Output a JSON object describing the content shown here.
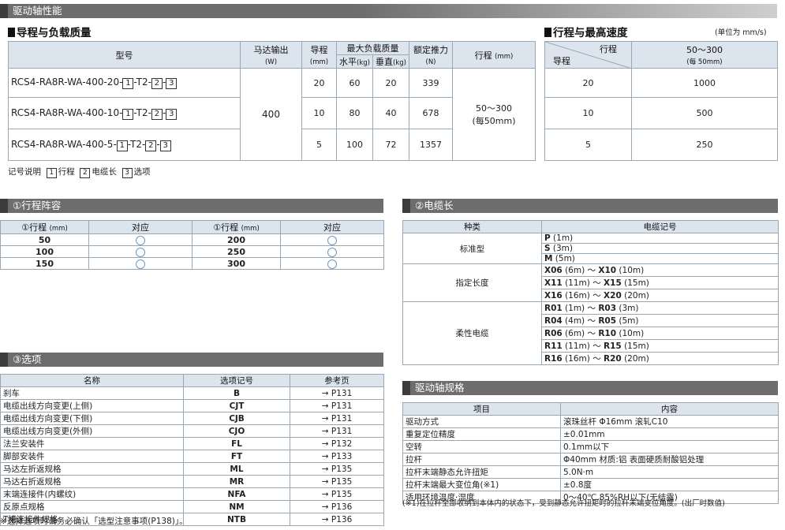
{
  "top_band": "驱动轴性能",
  "lead_section": {
    "title": "导程与负载质量",
    "headers": {
      "model": "型号",
      "motor": "马达输出",
      "motor_unit": "(W)",
      "lead": "导程",
      "lead_unit": "(mm)",
      "max_load": "最大负载质量",
      "horiz": "水平",
      "horiz_unit": "(kg)",
      "vert": "垂直",
      "vert_unit": "(kg)",
      "thrust": "额定推力",
      "thrust_unit": "(N)",
      "stroke": "行程",
      "stroke_unit": "(mm)"
    },
    "model_suffix": {
      "a": "-T2-",
      "b": "-"
    },
    "rows": [
      {
        "model_prefix": "RCS4-RA8R-WA-400-20-",
        "lead": "20",
        "horiz": "60",
        "vert": "20",
        "thrust": "339"
      },
      {
        "model_prefix": "RCS4-RA8R-WA-400-10-",
        "lead": "10",
        "horiz": "80",
        "vert": "40",
        "thrust": "678"
      },
      {
        "model_prefix": "RCS4-RA8R-WA-400-5-",
        "lead": "5",
        "horiz": "100",
        "vert": "72",
        "thrust": "1357"
      }
    ],
    "motor_value": "400",
    "stroke_value": "50～300",
    "stroke_pitch": "(每50mm)",
    "legend_label": "记号说明",
    "legend": [
      {
        "num": "1",
        "text": "行程"
      },
      {
        "num": "2",
        "text": "电缆长"
      },
      {
        "num": "3",
        "text": "选项"
      }
    ]
  },
  "speed_section": {
    "title": "行程与最高速度",
    "unit": "(单位为 mm/s)",
    "corner_top": "行程",
    "corner_bottom": "导程",
    "stroke_head": "50～300",
    "stroke_head_sub": "(每 50mm)",
    "rows": [
      {
        "lead": "20",
        "speed": "1000"
      },
      {
        "lead": "10",
        "speed": "500"
      },
      {
        "lead": "5",
        "speed": "250"
      }
    ]
  },
  "stroke_table": {
    "band": "①行程阵容",
    "headers": [
      "①行程",
      "(mm)",
      "对应"
    ],
    "left": [
      "50",
      "100",
      "150"
    ],
    "right": [
      "200",
      "250",
      "300"
    ]
  },
  "cable_table": {
    "band": "②电缆长",
    "headers": [
      "种类",
      "电缆记号"
    ],
    "groups": [
      {
        "type": "标准型",
        "lines": [
          {
            "a": "P",
            "an": "(1m)",
            "b": "",
            "bn": ""
          },
          {
            "a": "S",
            "an": "(3m)",
            "b": "",
            "bn": ""
          },
          {
            "a": "M",
            "an": "(5m)",
            "b": "",
            "bn": ""
          }
        ]
      },
      {
        "type": "指定长度",
        "lines": [
          {
            "a": "X06",
            "an": "(6m)",
            "b": "X10",
            "bn": "(10m)"
          },
          {
            "a": "X11",
            "an": "(11m)",
            "b": "X15",
            "bn": "(15m)"
          },
          {
            "a": "X16",
            "an": "(16m)",
            "b": "X20",
            "bn": "(20m)"
          }
        ]
      },
      {
        "type": "柔性电缆",
        "lines": [
          {
            "a": "R01",
            "an": "(1m)",
            "b": "R03",
            "bn": "(3m)"
          },
          {
            "a": "R04",
            "an": "(4m)",
            "b": "R05",
            "bn": "(5m)"
          },
          {
            "a": "R06",
            "an": "(6m)",
            "b": "R10",
            "bn": "(10m)"
          },
          {
            "a": "R11",
            "an": "(11m)",
            "b": "R15",
            "bn": "(15m)"
          },
          {
            "a": "R16",
            "an": "(16m)",
            "b": "R20",
            "bn": "(20m)"
          }
        ]
      }
    ],
    "sep": "～"
  },
  "options_table": {
    "band": "③选项",
    "headers": [
      "名称",
      "选项记号",
      "参考页"
    ],
    "rows": [
      {
        "name": "刹车",
        "code": "B",
        "page": "→ P131"
      },
      {
        "name": "电缆出线方向变更(上侧)",
        "code": "CJT",
        "page": "→ P131"
      },
      {
        "name": "电缆出线方向变更(下侧)",
        "code": "CJB",
        "page": "→ P131"
      },
      {
        "name": "电缆出线方向变更(外侧)",
        "code": "CJO",
        "page": "→ P131"
      },
      {
        "name": "法兰安装件",
        "code": "FL",
        "page": "→ P132"
      },
      {
        "name": "脚部安装件",
        "code": "FT",
        "page": "→ P133"
      },
      {
        "name": "马达左折返规格",
        "code": "ML",
        "page": "→ P135"
      },
      {
        "name": "马达右折返规格",
        "code": "MR",
        "page": "→ P135"
      },
      {
        "name": "末端连接件(内螺纹)",
        "code": "NFA",
        "page": "→ P135"
      },
      {
        "name": "反原点规格",
        "code": "NM",
        "page": "→ P136"
      },
      {
        "name": "T槽连接件规格",
        "code": "NTB",
        "page": "→ P136"
      }
    ],
    "note": "※选择选项时请务必确认「选型注意事项(P138)」。"
  },
  "spec_table": {
    "band": "驱动轴规格",
    "headers": [
      "项目",
      "内容"
    ],
    "rows": [
      {
        "item": "驱动方式",
        "content": "滚珠丝杆  Φ16mm  滚轧C10"
      },
      {
        "item": "重复定位精度",
        "content": "±0.01mm"
      },
      {
        "item": "空转",
        "content": "0.1mm以下"
      },
      {
        "item": "拉杆",
        "content": "Φ40mm  材质:铝  表面硬质耐酸铝处理"
      },
      {
        "item": "拉杆末端静态允许扭矩",
        "content": "5.0N·m"
      },
      {
        "item": "拉杆末端最大变位角(※1)",
        "content": "±0.8度"
      },
      {
        "item": "适用环境温度·湿度",
        "content": "0～40℃,85%RH以下(无结露)"
      }
    ],
    "note": "(※1)在拉杆全部收纳到本体内的状态下，受到静态允许扭矩时的拉杆末端变位角度。(出厂时数值)"
  },
  "circled": {
    "1": "1",
    "2": "2",
    "3": "3"
  }
}
